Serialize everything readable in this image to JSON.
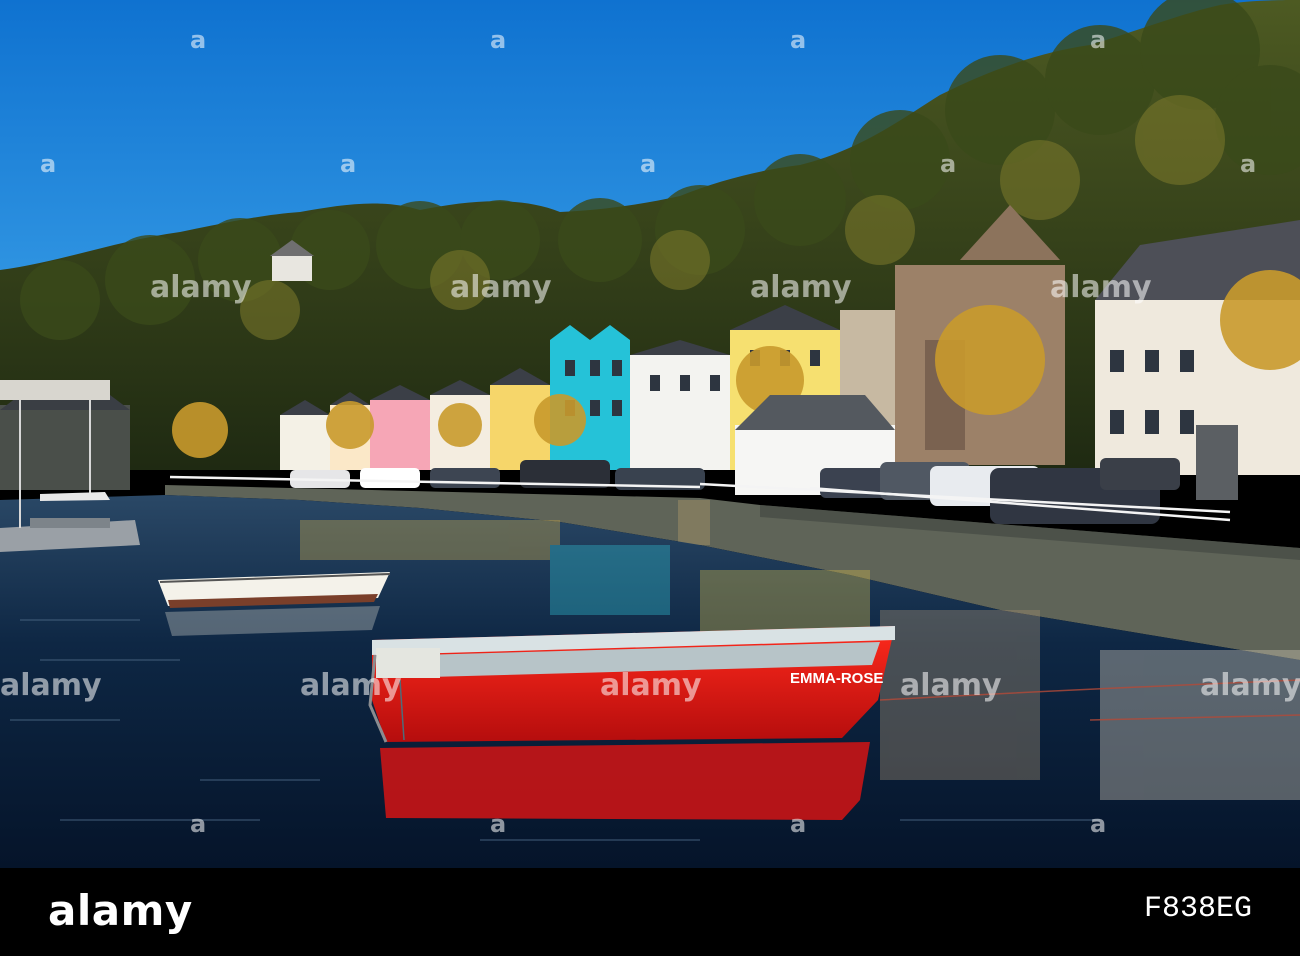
{
  "photo": {
    "boat_name": "EMMA-ROSE",
    "watermark_text": "alamy",
    "watermark_mark": "a"
  },
  "footer": {
    "brand": "alamy",
    "image_id": "F838EG"
  },
  "colors": {
    "sky": "#1a7fd6",
    "water": "#0d2a4a",
    "boat_hull": "#e01818",
    "footer_bg": "#000000"
  }
}
